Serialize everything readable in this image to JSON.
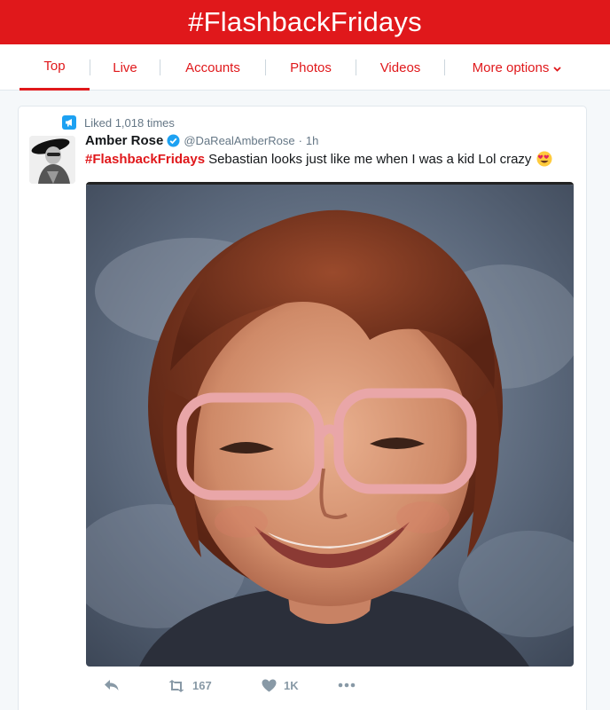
{
  "banner": {
    "title": "#FlashbackFridays"
  },
  "tabs": [
    {
      "label": "Top",
      "active": true
    },
    {
      "label": "Live",
      "active": false
    },
    {
      "label": "Accounts",
      "active": false
    },
    {
      "label": "Photos",
      "active": false
    },
    {
      "label": "Videos",
      "active": false
    },
    {
      "label": "More options",
      "active": false,
      "icon": "chevron-down-icon"
    }
  ],
  "tweet": {
    "context": "Liked 1,018 times",
    "context_icon": "megaphone-icon",
    "author_name": "Amber Rose",
    "verified": true,
    "handle": "@DaRealAmberRose",
    "separator": "·",
    "time": "1h",
    "hashtag": "#FlashbackFridays",
    "text": "Sebastian looks just like me when I was a kid Lol crazy",
    "emoji": "heart-eyes-emoji",
    "media_alt": "school portrait of a smiling child with reddish hair and pink glasses",
    "actions": {
      "reply_icon": "reply-icon",
      "retweet_count": "167",
      "like_count": "1K",
      "more_icon": "more-icon"
    }
  },
  "colors": {
    "brand": "#e0181b",
    "link_blue": "#1da1f2",
    "muted": "#657786",
    "action": "#8899a6"
  }
}
